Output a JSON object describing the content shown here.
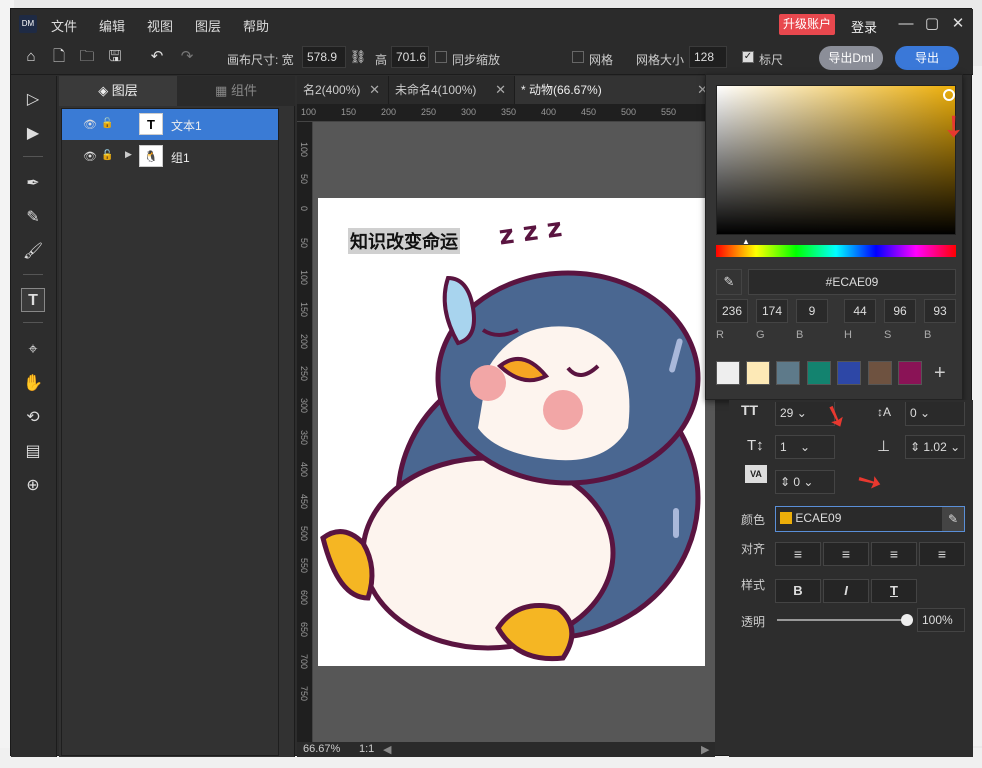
{
  "app": {
    "logo": "DM",
    "menu": [
      "文件",
      "编辑",
      "视图",
      "图层",
      "帮助"
    ],
    "upgrade": "升级账户",
    "login": "登录"
  },
  "toolbar": {
    "canvas_size_label": "画布尺寸: 宽",
    "width": "578.9",
    "height_label": "高",
    "height": "701.6",
    "sync_scale": "同步缩放",
    "grid": "网格",
    "grid_size_label": "网格大小",
    "grid_size": "128",
    "ruler": "标尺",
    "export_dml": "导出Dml",
    "export": "导出"
  },
  "layers_panel": {
    "tab_layers": "图层",
    "tab_components": "组件",
    "items": [
      {
        "name": "文本1",
        "thumb": "T",
        "selected": true
      },
      {
        "name": "组1",
        "thumb": "",
        "selected": false
      }
    ]
  },
  "doc_tabs": [
    {
      "label": "名2(400%)"
    },
    {
      "label": "未命名4(100%)"
    },
    {
      "label": "* 动物(66.67%)"
    }
  ],
  "ruler": {
    "h": [
      "100",
      "150",
      "200",
      "250",
      "300",
      "350",
      "400",
      "450",
      "500",
      "550"
    ],
    "v": [
      "100",
      "50",
      "0",
      "50",
      "100",
      "150",
      "200",
      "250",
      "300",
      "350",
      "400",
      "450",
      "500",
      "550",
      "600",
      "650",
      "700",
      "750"
    ]
  },
  "canvas": {
    "text": "知识改变命运",
    "zzz": "z z z"
  },
  "statusbar": {
    "zoom": "66.67%",
    "ratio": "1:1"
  },
  "color_picker": {
    "hex": "#ECAE09",
    "r": "236",
    "g": "174",
    "b": "9",
    "h": "44",
    "s": "96",
    "b2": "93",
    "labels": [
      "R",
      "G",
      "B",
      "H",
      "S",
      "B"
    ],
    "swatches": [
      "#eeeeee",
      "#fde9b6",
      "#5e7a8a",
      "#13836f",
      "#2d47a6",
      "#6e5240",
      "#8a1356"
    ],
    "add": "+"
  },
  "props": {
    "font_size": "29",
    "tracking": "0",
    "line_scale": "1",
    "line_height": "1.02",
    "va": "0",
    "color_label": "颜色",
    "color_value": "ECAE09",
    "align_label": "对齐",
    "style_label": "样式",
    "opacity_label": "透明",
    "opacity": "100%",
    "bold": "B",
    "italic": "I",
    "underline": "T"
  },
  "colors": {
    "accent": "#3a7bd5",
    "picked": "#ECAE09"
  }
}
